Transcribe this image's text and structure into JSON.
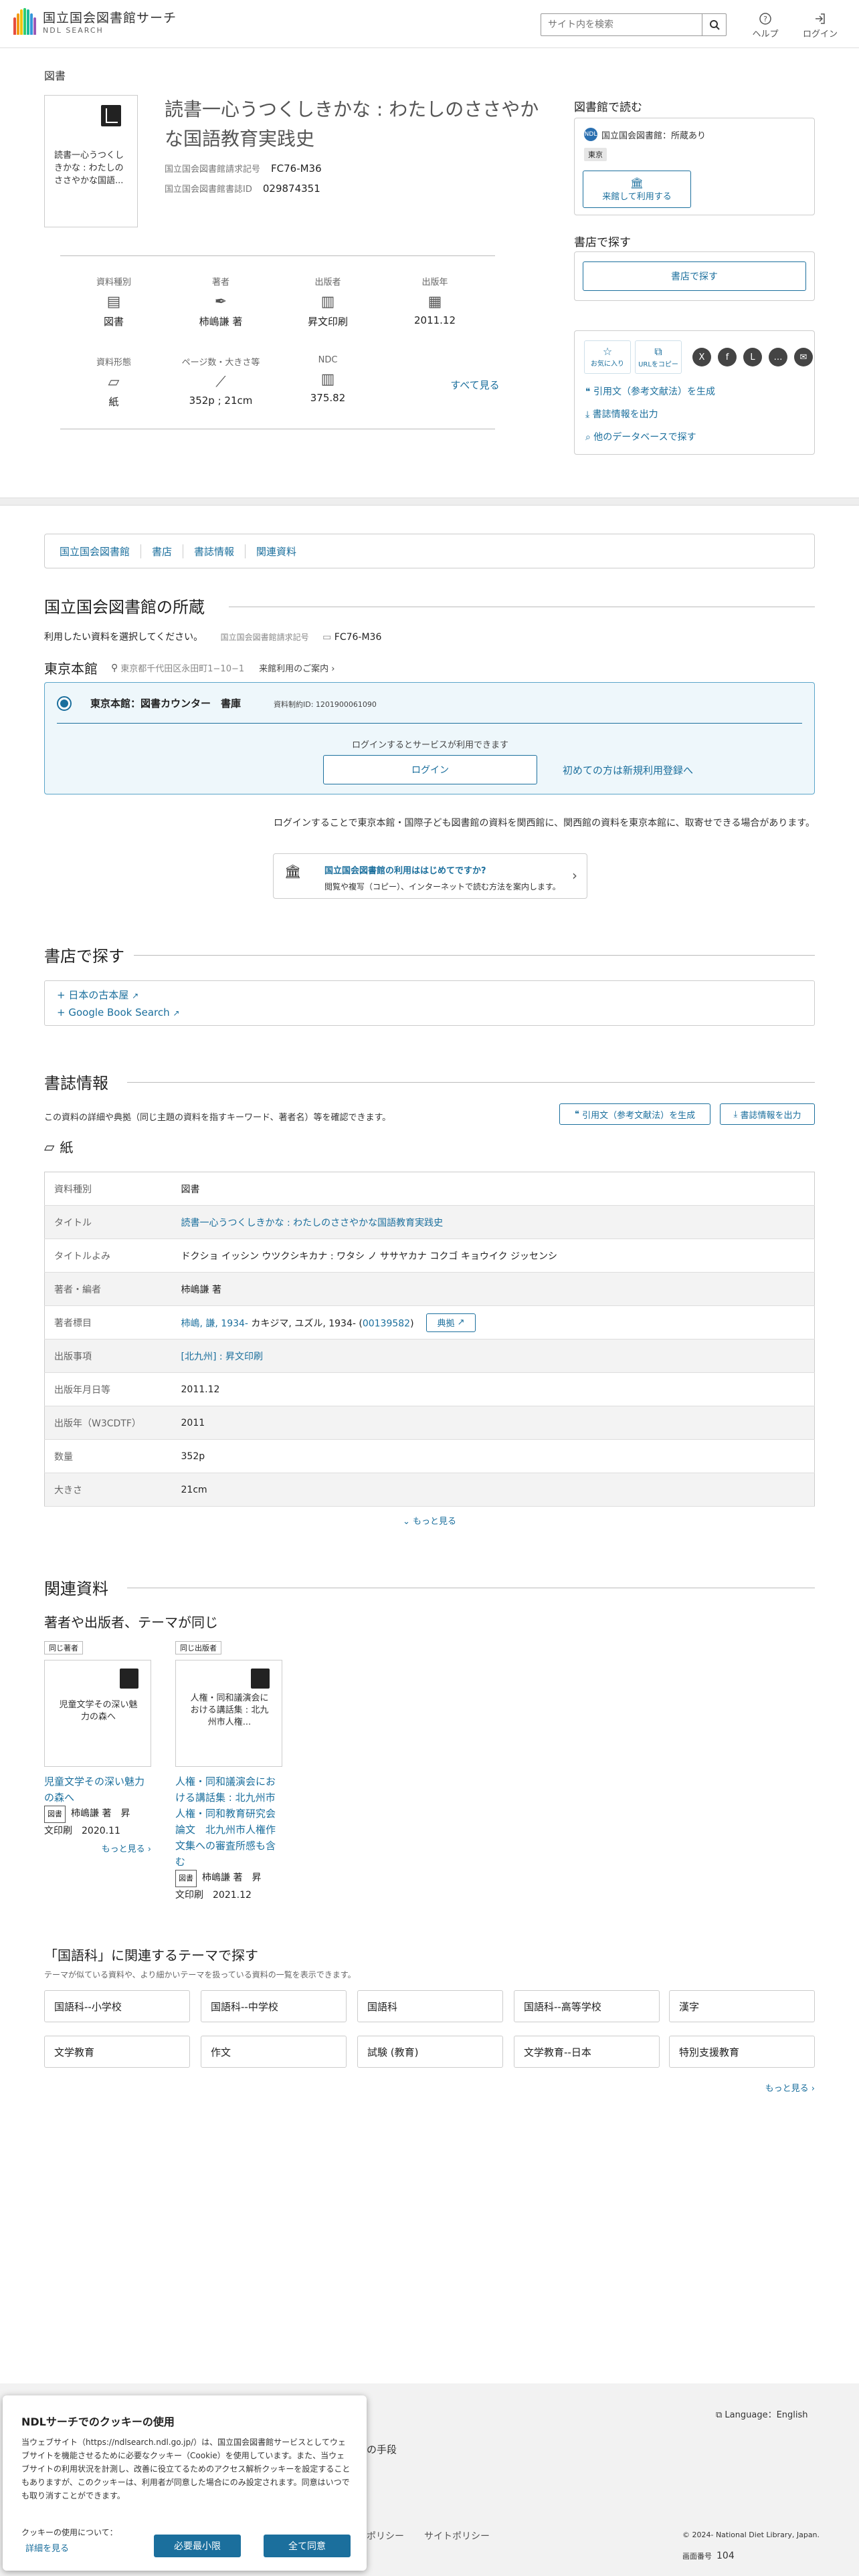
{
  "header": {
    "logo_jp": "国立国会図書館サーチ",
    "logo_en": "NDL SEARCH",
    "search_placeholder": "サイト内を検索",
    "help_label": "ヘルプ",
    "login_label": "ログイン"
  },
  "breadcrumb": "図書",
  "record": {
    "cover_text": "読書一心うつくしきかな : わたしのささやかな国語...",
    "title": "読書一心うつくしきかな : わたしのささやかな国語教育実践史",
    "callno_label": "国立国会図書館請求記号",
    "callno": "FC76-M36",
    "bibid_label": "国立国会図書館書誌ID",
    "bibid": "029874351",
    "facets": [
      {
        "label": "資料種別",
        "value": "図書",
        "icon": "book-icon"
      },
      {
        "label": "著者",
        "value": "柿嶋謙 著",
        "icon": "pen-icon"
      },
      {
        "label": "出版者",
        "value": "昇文印刷",
        "icon": "building-icon"
      },
      {
        "label": "出版年",
        "value": "2011.12",
        "icon": "calendar-icon"
      },
      {
        "label": "資料形態",
        "value": "紙",
        "icon": "paper-icon"
      },
      {
        "label": "ページ数・大きさ等",
        "value": "352p ; 21cm",
        "icon": "ruler-icon"
      },
      {
        "label": "NDC",
        "value": "375.82",
        "icon": "shelf-icon"
      }
    ],
    "see_all": "すべて見る"
  },
  "library_read": {
    "heading": "図書館で読む",
    "library": "国立国会図書館：所蔵あり",
    "tag": "東京",
    "visit_btn": "来館して利用する"
  },
  "bookstore_find": {
    "heading": "書店で探す",
    "btn": "書店で探す"
  },
  "share": {
    "fav": "お気に入り",
    "copy": "URLをコピー",
    "sns": [
      "X",
      "f",
      "L",
      "…",
      "✉"
    ],
    "cite_link": "引用文（参考文献法）を生成",
    "export_link": "書誌情報を出力",
    "other_db_link": "他のデータベースで探す"
  },
  "tabs": [
    "国立国会図書館",
    "書店",
    "書誌情報",
    "関連資料"
  ],
  "holdings": {
    "heading": "国立国会図書館の所蔵",
    "instruction": "利用したい資料を選択してください。",
    "callno_label": "国立国会図書館請求記号",
    "callno": "FC76-M36",
    "branch": "東京本館",
    "address": "東京都千代田区永田町1−10−1",
    "guide_link": "来館利用のご案内",
    "item_location": "東京本館：図書カウンター　書庫",
    "item_id": "資料制約ID: 1201900061090",
    "login_note": "ログインするとサービスが利用できます",
    "login_btn": "ログイン",
    "register_link": "初めての方は新規利用登録へ",
    "login_info": "ログインすることで東京本館・国際子ども図書館の資料を関西館に、関西館の資料を東京本館に、取寄せできる場合があります。",
    "promo_title": "国立国会図書館の利用ははじめてですか?",
    "promo_body": "閲覧や複写（コピー）、インターネットで読む方法を案内します。"
  },
  "bookstores": {
    "heading": "書店で探す",
    "links": [
      "日本の古本屋",
      "Google Book Search"
    ]
  },
  "biblio": {
    "heading": "書誌情報",
    "desc": "この資料の詳細や典拠（同じ主題の資料を指すキーワード、著者名）等を確認できます。",
    "cite_btn": "引用文（参考文献法）を生成",
    "export_btn": "書誌情報を出力",
    "form": "紙",
    "rows": [
      {
        "k": "資料種別",
        "v": "図書"
      },
      {
        "k": "タイトル",
        "v": "読書一心うつくしきかな : わたしのささやかな国語教育実践史"
      },
      {
        "k": "タイトルよみ",
        "v": "ドクショ イッシン ウツクシキカナ : ワタシ ノ ササヤカナ コクゴ キョウイク ジッセンシ"
      },
      {
        "k": "著者・編者",
        "v": "柿嶋謙 著"
      },
      {
        "k": "著者標目",
        "v": "柿嶋, 謙, 1934-",
        "v2": " カキジマ, ユズル, 1934- (",
        "v3": "00139582",
        "v4": ")",
        "badge": "典拠"
      },
      {
        "k": "出版事項",
        "v": "[北九州] : 昇文印刷"
      },
      {
        "k": "出版年月日等",
        "v": "2011.12"
      },
      {
        "k": "出版年（W3CDTF）",
        "v": "2011"
      },
      {
        "k": "数量",
        "v": "352p"
      },
      {
        "k": "大きさ",
        "v": "21cm"
      }
    ],
    "more": "もっと見る"
  },
  "related": {
    "heading": "関連資料",
    "subheading": "著者や出版者、テーマが同じ",
    "cards": [
      {
        "tag": "同じ著者",
        "cover": "児童文学その深い魅力の森へ",
        "title": "児童文学その深い魅力の森へ",
        "kind": "図書",
        "author": "柿嶋謙 著　昇",
        "pub": "文印刷　2020.11"
      },
      {
        "tag": "同じ出版者",
        "cover": "人権・同和議演会における講話集 : 北九州市人権...",
        "title": "人権・同和議演会における講話集 : 北九州市人権・同和教育研究会論文　北九州市人権作文集への審査所感も含む",
        "kind": "図書",
        "author": "柿嶋謙 著　昇",
        "pub": "文印刷　2021.12"
      }
    ],
    "more": "もっと見る"
  },
  "themes": {
    "heading": "「国語科」に関連するテーマで探す",
    "desc": "テーマが似ている資料や、より細かいテーマを扱っている資料の一覧を表示できます。",
    "items": [
      "国語科--小学校",
      "国語科--中学校",
      "国語科",
      "国語科--高等学校",
      "漢字",
      "文学教育",
      "作文",
      "試験 (教育)",
      "文学教育--日本",
      "特別支援教育"
    ],
    "more": "もっと見る"
  },
  "footer": {
    "language": "Language：English",
    "copyright": "© 2024- National Diet Library, Japan.",
    "screen_no_label": "画面番号",
    "screen_no": "104",
    "partial1": "の手段",
    "partial2": "ポリシー",
    "partial3": "サイトポリシー"
  },
  "cookie": {
    "title": "NDLサーチでのクッキーの使用",
    "body": "当ウェブサイト（https://ndlsearch.ndl.go.jp/）は、国立国会図書館サービスとしてウェブサイトを機能させるために必要なクッキー（Cookie）を使用しています。また、当ウェブサイトの利用状況を計測し、改善に役立てるためのアクセス解析クッキーを設定することもありますが、このクッキーは、利用者が同意した場合にのみ設定されます。同意はいつでも取り消すことができます。",
    "about": "クッキーの使用について：",
    "detail": "詳細を見る",
    "min_btn": "必要最小限",
    "all_btn": "全て同意"
  }
}
